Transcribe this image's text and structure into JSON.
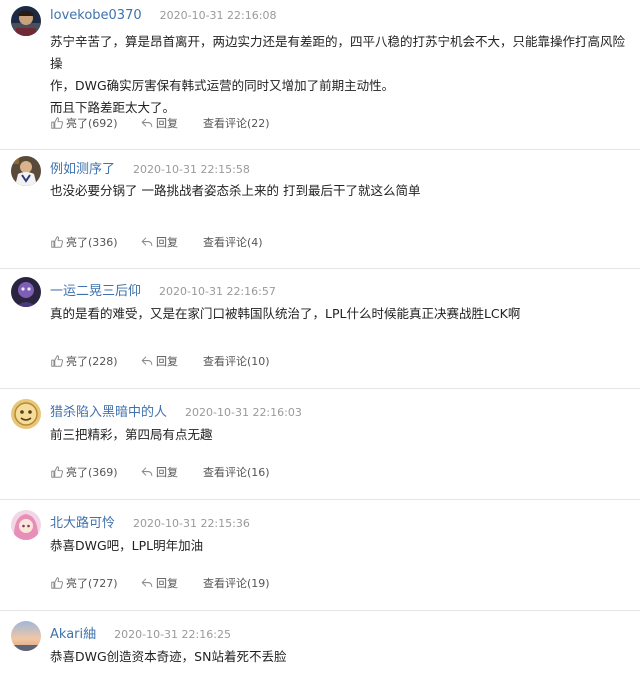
{
  "comments": [
    {
      "username": "lovekobe0370",
      "timestamp": "2020-10-31 22:16:08",
      "avatar_icon": "avatar-dark-player-icon",
      "content_lines": [
        "苏宁辛苦了，算是昂首离开，两边实力还是有差距的，四平八稳的打苏宁机会不大，只能靠操作打高风险操",
        "作，DWG确实厉害保有韩式运营的同时又增加了前期主动性。",
        "而且下路差距太大了。"
      ],
      "like_label": "亮了(692)",
      "reply_label": "回复",
      "view_label": "查看评论(22)"
    },
    {
      "username": "例如测序了",
      "timestamp": "2020-10-31 22:15:58",
      "avatar_icon": "avatar-team-jersey-icon",
      "content_lines": [
        "也没必要分锅了 一路挑战者姿态杀上来的 打到最后干了就这么简单"
      ],
      "like_label": "亮了(336)",
      "reply_label": "回复",
      "view_label": "查看评论(4)"
    },
    {
      "username": "一运二晃三后仰",
      "timestamp": "2020-10-31 22:16:57",
      "avatar_icon": "avatar-purple-character-icon",
      "content_lines": [
        "真的是看的难受，又是在家门口被韩国队统治了，LPL什么时候能真正决赛战胜LCK啊"
      ],
      "like_label": "亮了(228)",
      "reply_label": "回复",
      "view_label": "查看评论(10)"
    },
    {
      "username": "猎杀陷入黑暗中的人",
      "timestamp": "2020-10-31 22:16:03",
      "avatar_icon": "avatar-gold-emblem-icon",
      "content_lines": [
        "前三把精彩，第四局有点无趣"
      ],
      "like_label": "亮了(369)",
      "reply_label": "回复",
      "view_label": "查看评论(16)"
    },
    {
      "username": "北大路可怜",
      "timestamp": "2020-10-31 22:15:36",
      "avatar_icon": "avatar-pink-anime-icon",
      "content_lines": [
        "恭喜DWG吧，LPL明年加油"
      ],
      "like_label": "亮了(727)",
      "reply_label": "回复",
      "view_label": "查看评论(19)"
    },
    {
      "username": "Akari紬",
      "timestamp": "2020-10-31 22:16:25",
      "avatar_icon": "avatar-sunset-sky-icon",
      "content_lines": [
        "恭喜DWG创造资本奇迹，SN站着死不丢脸"
      ],
      "like_label": "",
      "reply_label": "",
      "view_label": ""
    }
  ]
}
